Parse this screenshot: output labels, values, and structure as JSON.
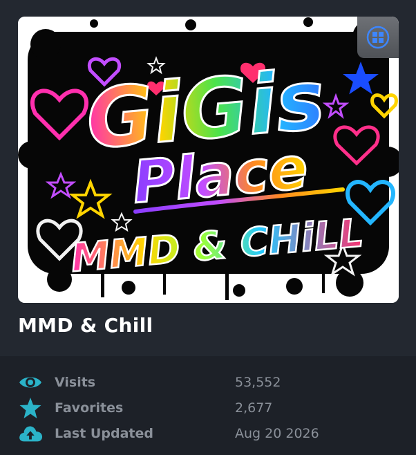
{
  "card": {
    "title": "MMD & Chill",
    "thumbnail": {
      "line1": "GiGis",
      "line2": "Place",
      "line3": "MMD & CHiLL",
      "platform_icon": "windows-icon"
    },
    "stats": [
      {
        "icon": "eye-icon",
        "label": "Visits",
        "value": "53,552"
      },
      {
        "icon": "star-icon",
        "label": "Favorites",
        "value": "2,677"
      },
      {
        "icon": "cloud-upload-icon",
        "label": "Last Updated",
        "value": "Aug 20 2026"
      }
    ]
  },
  "colors": {
    "accent": "#2bb3c8",
    "background": "#1f242b",
    "text_muted": "#8a9099",
    "title": "#ffffff"
  }
}
